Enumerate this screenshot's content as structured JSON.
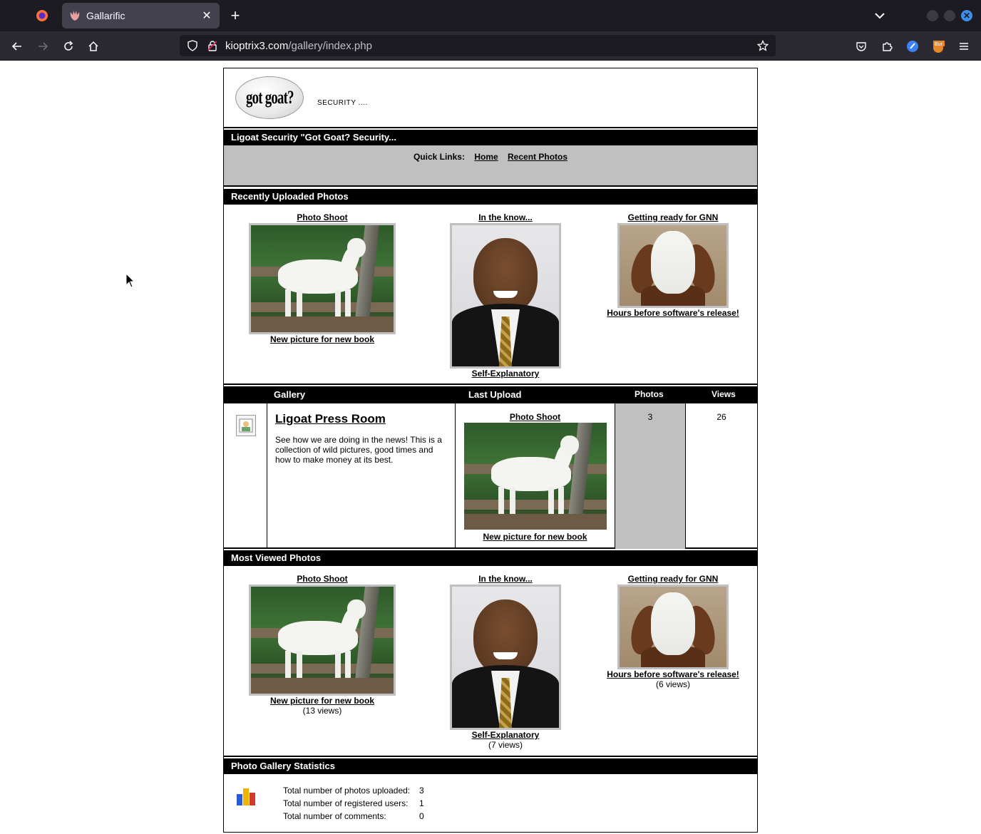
{
  "browser": {
    "tab_title": "Gallarific",
    "url_domain": "kioptrix3.com",
    "url_path": "/gallery/index.php"
  },
  "header": {
    "logo_text": "got goat?",
    "tagline": "SECURITY ...."
  },
  "site_bar": "Ligoat Security \"Got Goat? Security...",
  "quick_links": {
    "label": "Quick Links:",
    "items": [
      "Home",
      "Recent Photos"
    ]
  },
  "recent": {
    "heading": "Recently Uploaded Photos",
    "photos": [
      {
        "title": "Photo Shoot",
        "caption": "New picture for new book"
      },
      {
        "title": "In the know...",
        "caption": "Self-Explanatory"
      },
      {
        "title": "Getting ready for GNN",
        "caption": "Hours before software's release!"
      }
    ]
  },
  "gallery_table": {
    "headers": {
      "gallery": "Gallery",
      "last_upload": "Last Upload",
      "photos": "Photos",
      "views": "Views"
    },
    "row": {
      "title": "Ligoat Press Room",
      "description": "See how we are doing in the news! This is a collection of wild pictures, good times and how to make money at its best.",
      "last_upload_title": "Photo Shoot",
      "last_upload_caption": "New picture for new book",
      "photos": "3",
      "views": "26"
    }
  },
  "most_viewed": {
    "heading": "Most Viewed Photos",
    "photos": [
      {
        "title": "Photo Shoot",
        "caption": "New picture for new book",
        "views": "(13 views)"
      },
      {
        "title": "In the know...",
        "caption": "Self-Explanatory",
        "views": "(7 views)"
      },
      {
        "title": "Getting ready for GNN",
        "caption": "Hours before software's release!",
        "views": "(6 views)"
      }
    ]
  },
  "stats": {
    "heading": "Photo Gallery Statistics",
    "rows": [
      {
        "label": "Total number of photos uploaded:",
        "value": "3"
      },
      {
        "label": "Total number of registered users:",
        "value": "1"
      },
      {
        "label": "Total number of comments:",
        "value": "0"
      }
    ]
  }
}
